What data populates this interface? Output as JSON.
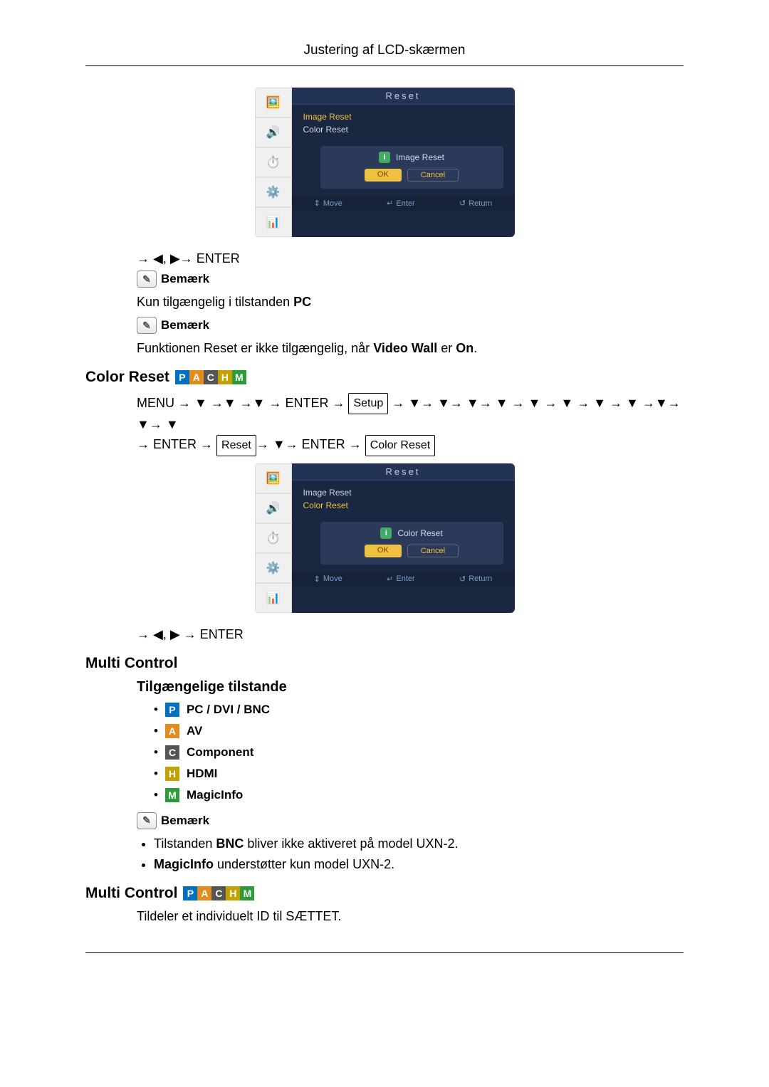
{
  "header": {
    "title": "Justering af LCD-skærmen"
  },
  "osd1": {
    "title": "Reset",
    "items": [
      "Image Reset",
      "Color Reset"
    ],
    "dialog": {
      "title": "Image Reset",
      "ok": "OK",
      "cancel": "Cancel"
    },
    "footer": {
      "move": "Move",
      "enter": "Enter",
      "return": "Return"
    }
  },
  "nav1": "→ ◀, ▶→ ENTER",
  "note_label": "Bemærk",
  "note1_body_pre": "Kun tilgængelig i tilstanden ",
  "note1_body_b": "PC",
  "note2_body_pre": "Funktionen Reset er ikke tilgængelig, når ",
  "note2_body_b1": "Video Wall",
  "note2_body_mid": " er ",
  "note2_body_b2": "On",
  "note2_body_post": ".",
  "section_color_reset": "Color Reset",
  "menu_path": {
    "menu": "MENU",
    "enter": "ENTER",
    "setup": "Setup",
    "reset": "Reset",
    "color_reset": "Color Reset"
  },
  "osd2": {
    "title": "Reset",
    "items": [
      "Image Reset",
      "Color Reset"
    ],
    "dialog": {
      "title": "Color Reset",
      "ok": "OK",
      "cancel": "Cancel"
    },
    "footer": {
      "move": "Move",
      "enter": "Enter",
      "return": "Return"
    }
  },
  "nav2": "→ ◀, ▶ → ENTER",
  "section_multi_control": "Multi Control",
  "sub_modes": "Tilgængelige tilstande",
  "modes": {
    "p": "PC / DVI / BNC",
    "a": "AV",
    "c": "Component",
    "h": "HDMI",
    "m": "MagicInfo"
  },
  "note3_li1_pre": "Tilstanden ",
  "note3_li1_b": "BNC",
  "note3_li1_post": " bliver ikke aktiveret på model UXN-2.",
  "note3_li2_b": "MagicInfo",
  "note3_li2_post": " understøtter kun model UXN-2.",
  "section_multi_control2": "Multi Control",
  "mc_desc": "Tildeler et individuelt ID til SÆTTET."
}
